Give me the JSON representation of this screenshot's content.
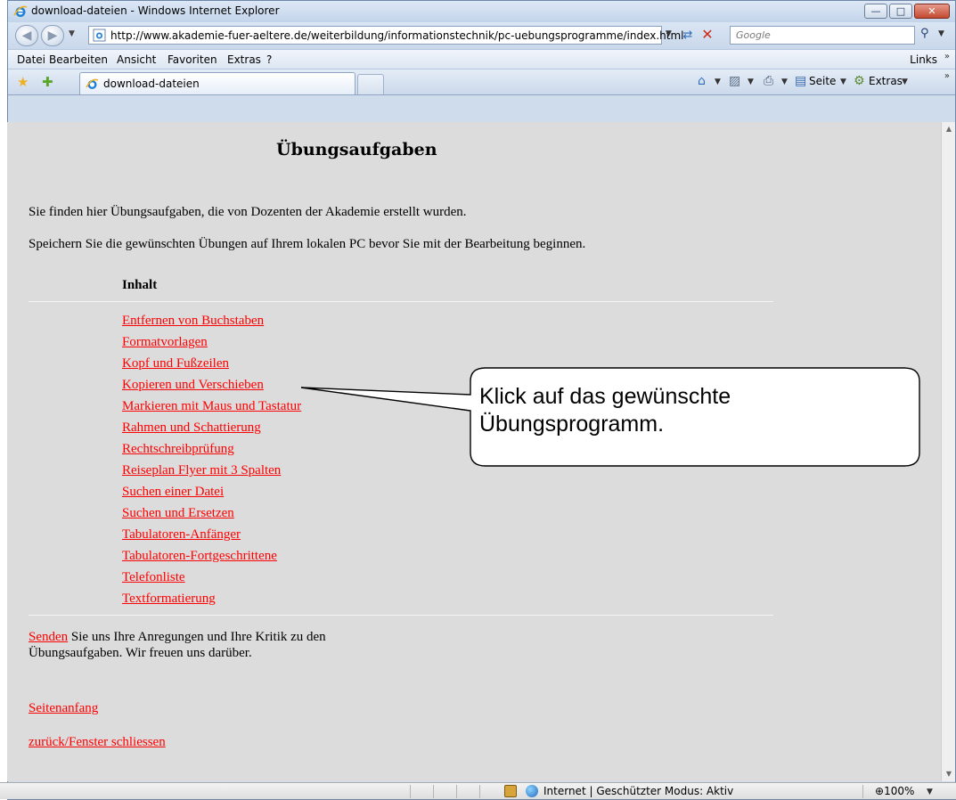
{
  "window": {
    "title": "download-dateien - Windows Internet Explorer"
  },
  "toolbar": {
    "address": "http://www.akademie-fuer-aeltere.de/weiterbildung/informationstechnik/pc-uebungsprogramme/index.html",
    "search_placeholder": "Google"
  },
  "menu": {
    "items": [
      "Datei",
      "Bearbeiten",
      "Ansicht",
      "Favoriten",
      "Extras",
      "?"
    ],
    "links_label": "Links"
  },
  "tabs": {
    "active_label": "download-dateien",
    "seite_label": "Seite",
    "extras_label": "Extras"
  },
  "page": {
    "heading": "Übungsaufgaben",
    "intro": "Sie finden hier Übungsaufgaben, die von Dozenten der Akademie erstellt wurden.",
    "instruction": "Speichern Sie die gewünschten Übungen auf Ihrem lokalen PC bevor Sie mit der Bearbeitung beginnen.",
    "toc_heading": "Inhalt",
    "links": [
      "Entfernen von Buchstaben",
      "Formatvorlagen",
      "Kopf und Fußzeilen",
      "Kopieren und Verschieben",
      "Markieren mit Maus und Tastatur",
      "Rahmen und Schattierung",
      "Rechtschreibprüfung",
      "Reiseplan Flyer mit 3 Spalten",
      "Suchen einer Datei",
      "Suchen und Ersetzen",
      "Tabulatoren-Anfänger",
      "Tabulatoren-Fortgeschrittene",
      "Telefonliste",
      "Textformatierung"
    ],
    "feedback_link": "Senden",
    "feedback_text_1": " Sie uns Ihre Anregungen und Ihre Kritik zu den",
    "feedback_text_2": "Übungsaufgaben. Wir freuen uns darüber.",
    "top_link": "Seitenanfang",
    "close_link": "zurück/Fenster schliessen"
  },
  "callout": {
    "line1": "Klick auf das gewünschte",
    "line2": "Übungsprogramm."
  },
  "statusbar": {
    "zone": "Internet | Geschützter Modus: Aktiv",
    "zoom": "100%"
  },
  "colors": {
    "link": "#ff0000",
    "page_background": "#dcdcdc"
  }
}
